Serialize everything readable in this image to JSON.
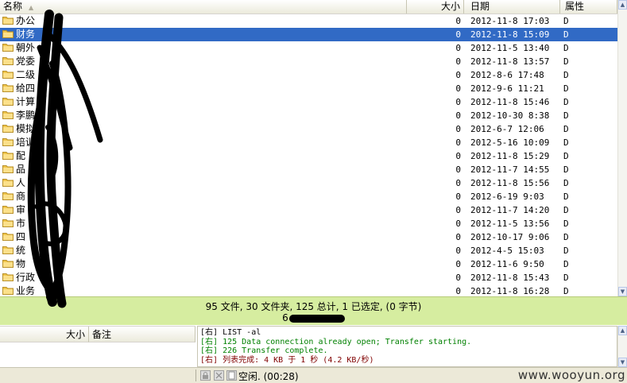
{
  "file_list": {
    "columns": {
      "name": "名称",
      "size": "大小",
      "date": "日期",
      "attr": "属性"
    },
    "rows": [
      {
        "name": "办公",
        "size": "0",
        "date": "2012-11-8 17:03",
        "attr": "D",
        "selected": false
      },
      {
        "name": "财务",
        "size": "0",
        "date": "2012-11-8 15:09",
        "attr": "D",
        "selected": true
      },
      {
        "name": "朝外",
        "size": "0",
        "date": "2012-11-5 13:40",
        "attr": "D",
        "selected": false
      },
      {
        "name": "党委",
        "size": "0",
        "date": "2012-11-8 13:57",
        "attr": "D",
        "selected": false
      },
      {
        "name": "二级",
        "size": "0",
        "date": "2012-8-6 17:48",
        "attr": "D",
        "selected": false
      },
      {
        "name": "给四",
        "size": "0",
        "date": "2012-9-6 11:21",
        "attr": "D",
        "selected": false
      },
      {
        "name": "计算",
        "size": "0",
        "date": "2012-11-8 15:46",
        "attr": "D",
        "selected": false
      },
      {
        "name": "李鹏",
        "size": "0",
        "date": "2012-10-30 8:38",
        "attr": "D",
        "selected": false
      },
      {
        "name": "模拟",
        "size": "0",
        "date": "2012-6-7 12:06",
        "attr": "D",
        "selected": false
      },
      {
        "name": "培训",
        "size": "0",
        "date": "2012-5-16 10:09",
        "attr": "D",
        "selected": false
      },
      {
        "name": "配",
        "size": "0",
        "date": "2012-11-8 15:29",
        "attr": "D",
        "selected": false
      },
      {
        "name": "品",
        "size": "0",
        "date": "2012-11-7 14:55",
        "attr": "D",
        "selected": false
      },
      {
        "name": "人",
        "size": "0",
        "date": "2012-11-8 15:56",
        "attr": "D",
        "selected": false
      },
      {
        "name": "商",
        "size": "0",
        "date": "2012-6-19 9:03",
        "attr": "D",
        "selected": false
      },
      {
        "name": "审",
        "size": "0",
        "date": "2012-11-7 14:20",
        "attr": "D",
        "selected": false
      },
      {
        "name": "市",
        "size": "0",
        "date": "2012-11-5 13:56",
        "attr": "D",
        "selected": false
      },
      {
        "name": "四",
        "size": "0",
        "date": "2012-10-17 9:06",
        "attr": "D",
        "selected": false
      },
      {
        "name": "统",
        "size": "0",
        "date": "2012-4-5 15:03",
        "attr": "D",
        "selected": false
      },
      {
        "name": "物",
        "size": "0",
        "date": "2012-11-6 9:50",
        "attr": "D",
        "selected": false
      },
      {
        "name": "行政",
        "size": "0",
        "date": "2012-11-8 15:43",
        "attr": "D",
        "selected": false
      },
      {
        "name": "业务",
        "size": "0",
        "date": "2012-11-8 16:28",
        "attr": "D",
        "selected": false
      }
    ]
  },
  "status": {
    "summary": "95 文件, 30 文件夹, 125 总计, 1 已选定, (0 字节)",
    "host": "6"
  },
  "lower_left": {
    "col_size": "大小",
    "col_note": "备注"
  },
  "log": [
    {
      "tag": "[右]",
      "text": " LIST -al",
      "color": "normal"
    },
    {
      "tag": "[右]",
      "text": " 125 Data connection already open; Transfer starting.",
      "color": "green"
    },
    {
      "tag": "[右]",
      "text": " 226 Transfer complete.",
      "color": "green"
    },
    {
      "tag": "[右]",
      "text": " 列表完成: 4 KB 于 1 秒 (4.2 KB/秒)",
      "color": "red"
    }
  ],
  "bottom": {
    "idle": "空闲. (00:28)",
    "watermark": "www.wooyun.org"
  },
  "colors": {
    "selected_row": "#316ac5",
    "status_band": "#d6eda0",
    "folder": "#f0c54a"
  }
}
